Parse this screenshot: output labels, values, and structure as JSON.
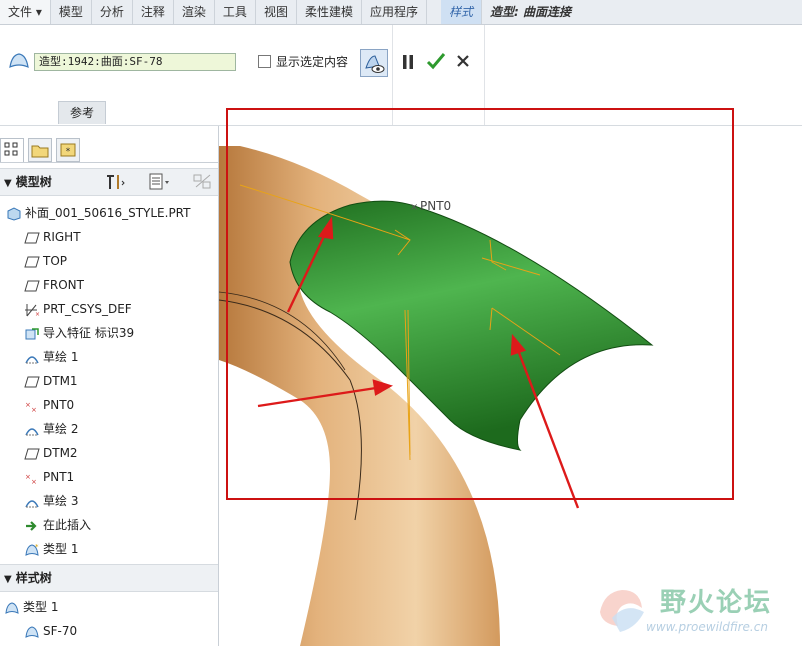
{
  "menubar": {
    "file": "文件",
    "items": [
      "模型",
      "分析",
      "注释",
      "渲染",
      "工具",
      "视图",
      "柔性建模",
      "应用程序"
    ],
    "active": "样式",
    "context": "造型: 曲面连接"
  },
  "ribbon": {
    "reference_value": "造型:1942:曲面:SF-78",
    "show_selected_label": "显示选定内容",
    "ref_tab": "参考"
  },
  "model_tree": {
    "header": "模型树",
    "items": [
      {
        "label": "补面_001_50616_STYLE.PRT",
        "icon": "part-icon"
      },
      {
        "label": "RIGHT",
        "icon": "datum-plane-icon"
      },
      {
        "label": "TOP",
        "icon": "datum-plane-icon"
      },
      {
        "label": "FRONT",
        "icon": "datum-plane-icon"
      },
      {
        "label": "PRT_CSYS_DEF",
        "icon": "csys-icon"
      },
      {
        "label": "导入特征 标识39",
        "icon": "import-feature-icon"
      },
      {
        "label": "草绘 1",
        "icon": "sketch-icon"
      },
      {
        "label": "DTM1",
        "icon": "datum-plane-icon"
      },
      {
        "label": "PNT0",
        "icon": "datum-point-icon"
      },
      {
        "label": "草绘 2",
        "icon": "sketch-icon"
      },
      {
        "label": "DTM2",
        "icon": "datum-plane-icon"
      },
      {
        "label": "PNT1",
        "icon": "datum-point-icon"
      },
      {
        "label": "草绘 3",
        "icon": "sketch-icon"
      },
      {
        "label": "在此插入",
        "icon": "insert-here-icon"
      },
      {
        "label": "类型 1",
        "icon": "style-feature-icon"
      }
    ]
  },
  "style_tree": {
    "header": "样式树",
    "items": [
      {
        "label": "类型 1",
        "icon": "style-feature-icon"
      },
      {
        "label": "SF-70",
        "icon": "surface-icon"
      }
    ]
  },
  "viewport": {
    "point_label": "PNT0",
    "colors": {
      "surface": "#2f8f2f",
      "model": "#d9a066",
      "annotation": "#cc1111",
      "curve": "#e8a317"
    }
  },
  "watermark": {
    "title": "野火论坛",
    "url": "www.proewildfire.cn"
  }
}
